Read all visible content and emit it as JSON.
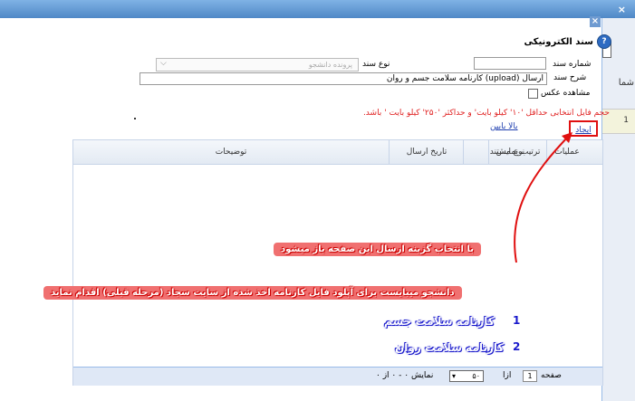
{
  "dialog": {
    "title": "سند الکترونیکی",
    "help_icon": "?",
    "close_icon": "×"
  },
  "form": {
    "doc_number_label": "شماره سند",
    "doc_number_value": "",
    "doc_type_label": "نوع سند",
    "doc_type_value": "پرونده دانشجو",
    "doc_desc_label": "شرح سند",
    "doc_desc_value": "ارسال (upload) کارنامه سلامت جسم و روان",
    "view_photo_label": "مشاهده عکس"
  },
  "messages": {
    "size_warning": "حجم فایل انتخابی حداقل '۱۰' کیلو بایت' و حداکثر '۲۵۰' کیلو بایت ' باشد."
  },
  "links": {
    "upload": "بالا  بابین",
    "create": "ایجاد"
  },
  "grid": {
    "columns": [
      "عملیات",
      "ترتیب نمایش",
      "نوع مستند",
      "تاریخ ارسال",
      "توضیحات"
    ]
  },
  "pager": {
    "page_label": "صفحه",
    "page_value": "1",
    "of_label": "ازا",
    "page_size": "۵۰",
    "showing": "نمایش ۰ - ۰ از ۰"
  },
  "annotations": {
    "banner1": "با انتخاب گزینه ارسال این صفحه باز میشود",
    "banner2": "دانشجو میبایست برای آپلود فایل کارنامه اخذ شده از سایت سجاد (مرحله قبلی) اقدام نماید",
    "item1_num": "1",
    "item1": "کارنامه سلامت جسم",
    "item2_num": "2",
    "item2": "کارنامه سلامت روان"
  },
  "side": {
    "label": "شما",
    "row_value": "1"
  },
  "colors": {
    "accent": "#4f88c6",
    "warning": "#e02020",
    "annotation_red": "#f07070",
    "annotation_blue": "#1a1acc"
  }
}
